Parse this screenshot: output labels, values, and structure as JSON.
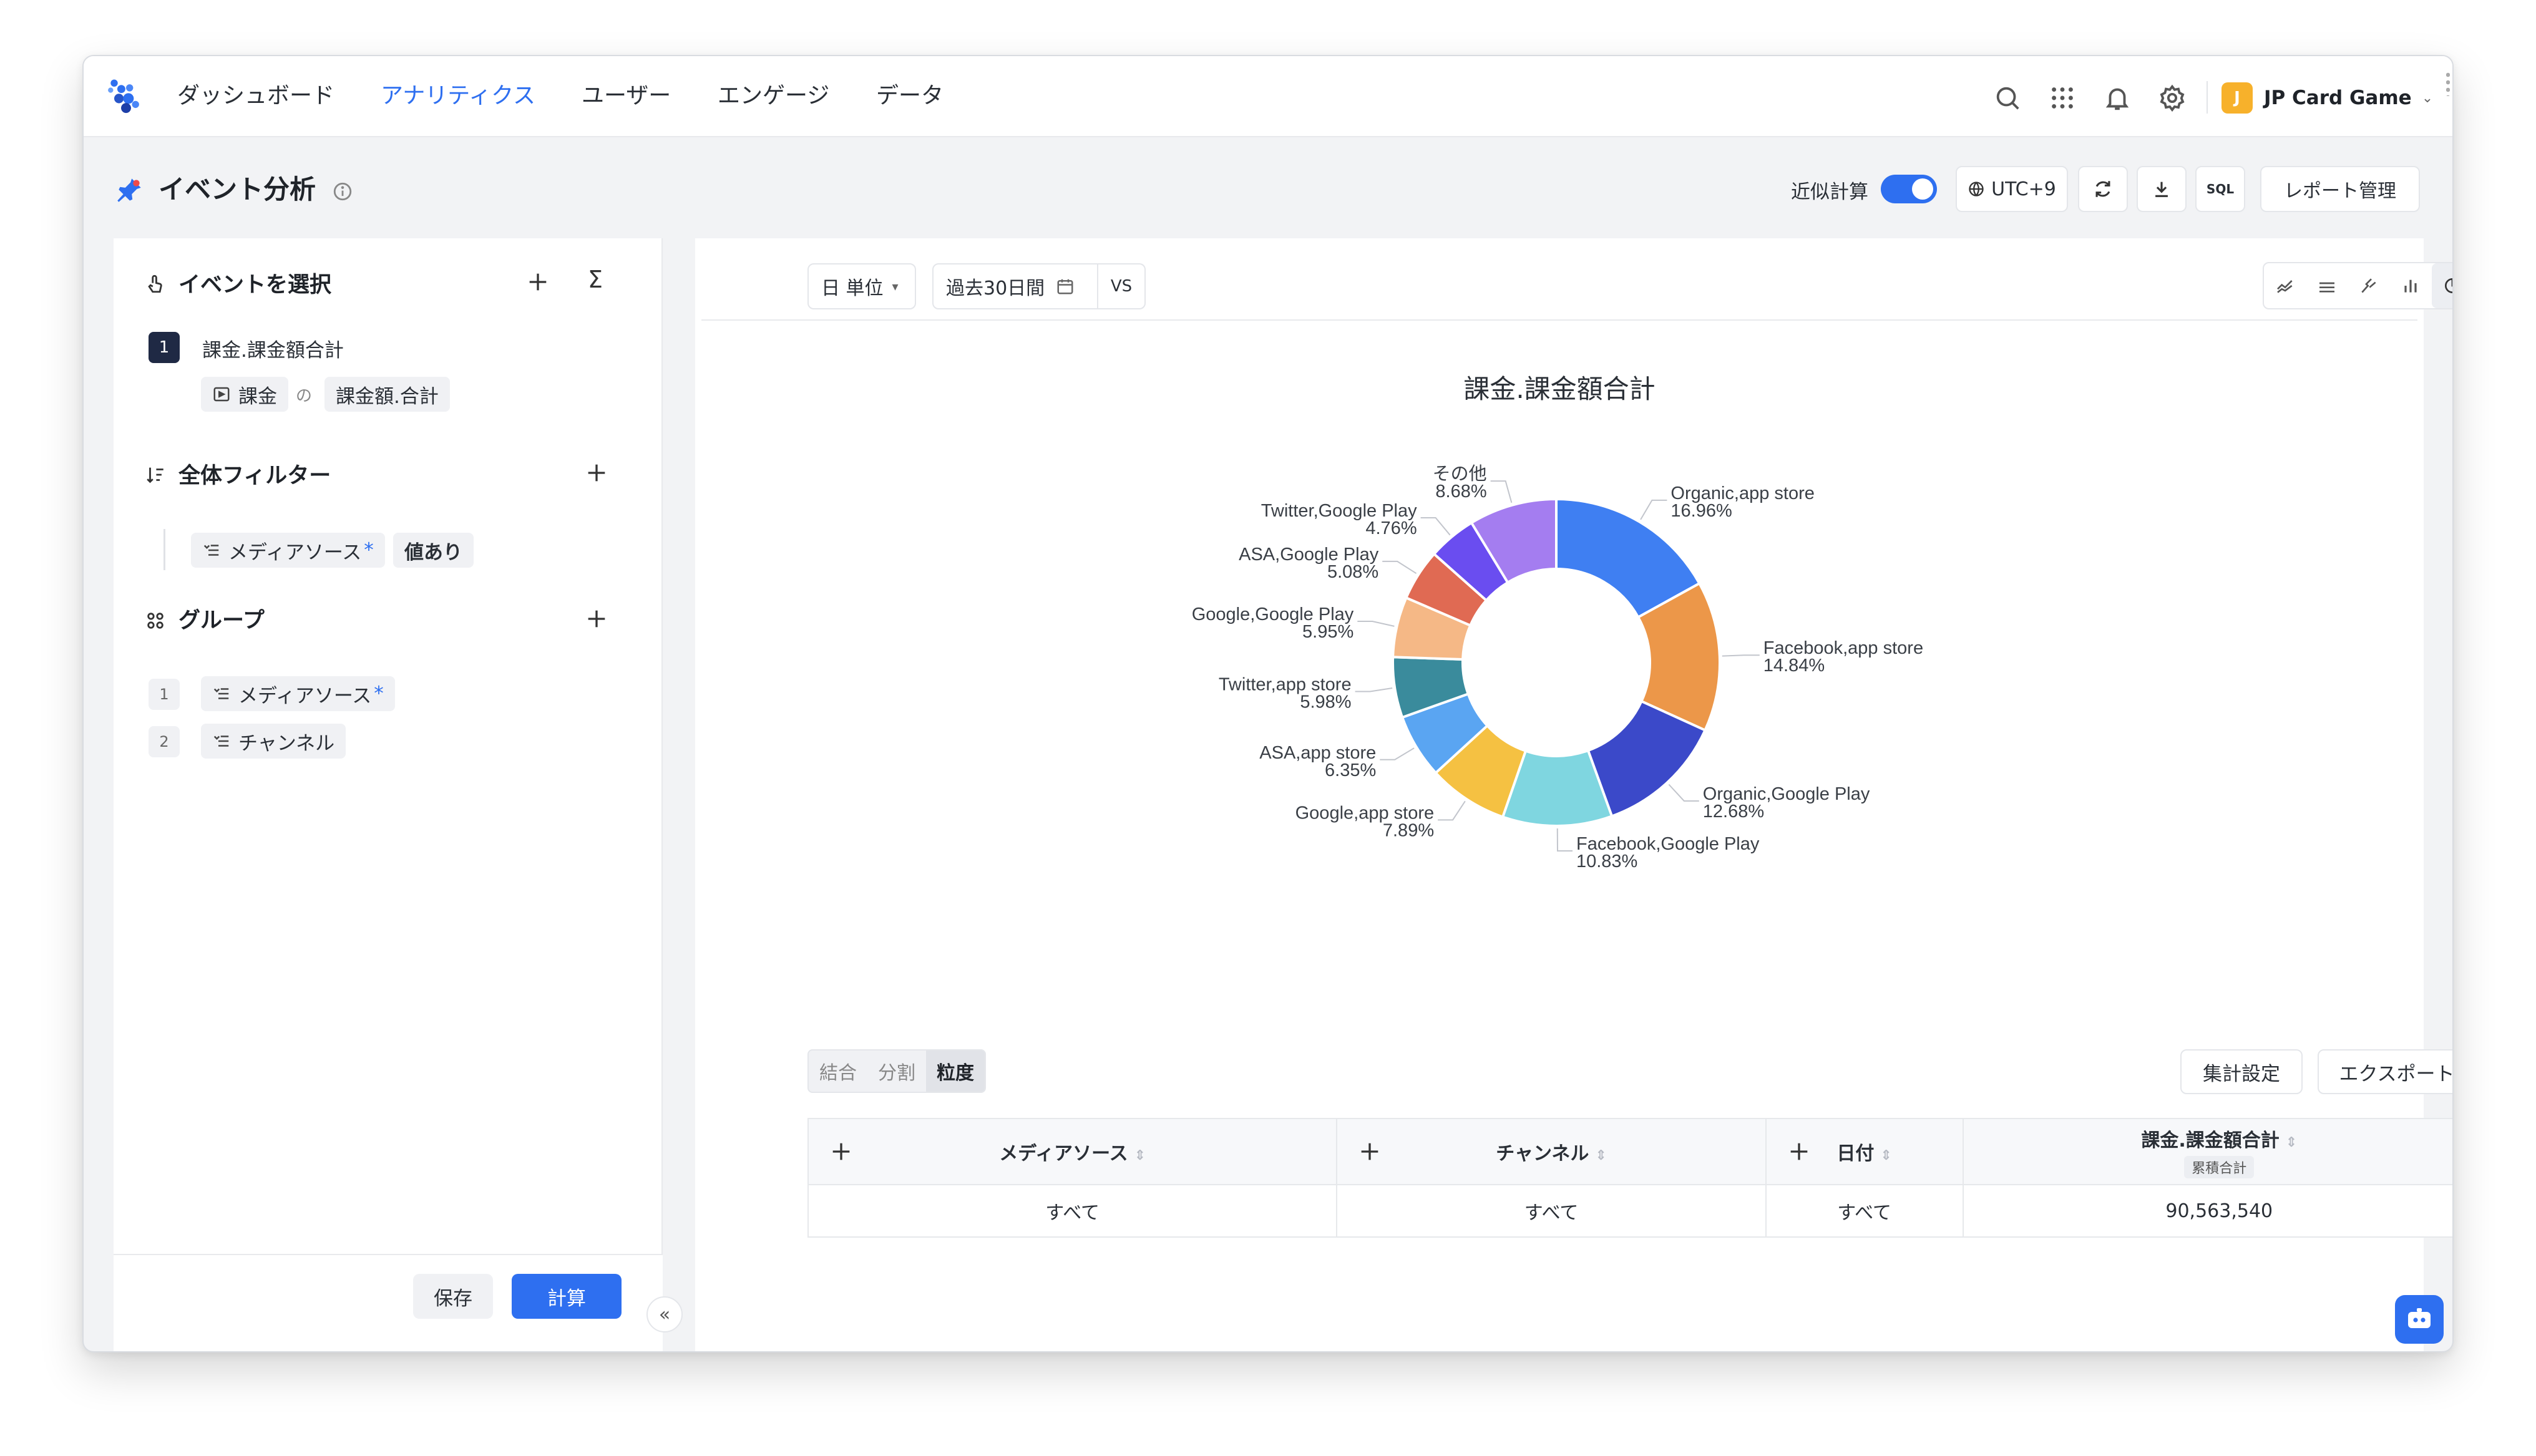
{
  "nav": {
    "items": [
      "ダッシュボード",
      "アナリティクス",
      "ユーザー",
      "エンゲージ",
      "データ"
    ],
    "active_index": 1,
    "accent_color": "#2e6ff0",
    "icons": [
      "search-icon",
      "apps-grid-icon",
      "bell-icon",
      "gear-icon"
    ],
    "project": {
      "avatar_letter": "J",
      "name": "JP Card Game",
      "avatar_color": "#f7b12b"
    }
  },
  "header": {
    "title": "イベント分析",
    "approx_label": "近似計算",
    "approx_on": true,
    "timezone": "UTC+9",
    "sql_label": "SQL",
    "report_button": "レポート管理"
  },
  "left": {
    "event_section": {
      "title": "イベントを選択",
      "sigma": "Σ"
    },
    "event": {
      "index": "1",
      "name": "課金.課金額合計",
      "source": "課金",
      "of": "の",
      "metric": "課金額.合計"
    },
    "filter_section": {
      "title": "全体フィルター"
    },
    "filter": {
      "field": "メディアソース",
      "star": "*",
      "condition": "値あり"
    },
    "group_section": {
      "title": "グループ"
    },
    "groups": [
      {
        "index": "1",
        "label": "メディアソース",
        "star": "*"
      },
      {
        "index": "2",
        "label": "チャンネル",
        "star": ""
      }
    ],
    "save_button": "保存",
    "calc_button": "計算",
    "collapse": "«"
  },
  "toolbar": {
    "granularity": "日 単位",
    "date_range": "過去30日間",
    "vs": "VS"
  },
  "chart_data": {
    "type": "pie",
    "donut": true,
    "title": "課金.課金額合計",
    "slices": [
      {
        "label": "Organic,app store",
        "percent": "16.96%",
        "value": 16.96,
        "color": "#3f7ff2"
      },
      {
        "label": "Facebook,app store",
        "percent": "14.84%",
        "value": 14.84,
        "color": "#ec9749"
      },
      {
        "label": "Organic,Google Play",
        "percent": "12.68%",
        "value": 12.68,
        "color": "#3b49c9"
      },
      {
        "label": "Facebook,Google Play",
        "percent": "10.83%",
        "value": 10.83,
        "color": "#7fd6e0"
      },
      {
        "label": "Google,app store",
        "percent": "7.89%",
        "value": 7.89,
        "color": "#f5c142"
      },
      {
        "label": "ASA,app store",
        "percent": "6.35%",
        "value": 6.35,
        "color": "#5aa5f2"
      },
      {
        "label": "Twitter,app store",
        "percent": "5.98%",
        "value": 5.98,
        "color": "#3a8b9c"
      },
      {
        "label": "Google,Google Play",
        "percent": "5.95%",
        "value": 5.95,
        "color": "#f5b886"
      },
      {
        "label": "ASA,Google Play",
        "percent": "5.08%",
        "value": 5.08,
        "color": "#e06a53"
      },
      {
        "label": "Twitter,Google Play",
        "percent": "4.76%",
        "value": 4.76,
        "color": "#6a4df0"
      },
      {
        "label": "その他",
        "percent": "8.68%",
        "value": 8.68,
        "color": "#a47df0"
      }
    ]
  },
  "table_tabs": {
    "items": [
      "結合",
      "分割",
      "粒度"
    ],
    "active_index": 2
  },
  "table_buttons": {
    "settings": "集計設定",
    "export": "エクスポート"
  },
  "table": {
    "headers": [
      {
        "label": "メディアソース"
      },
      {
        "label": "チャンネル"
      },
      {
        "label": "日付"
      },
      {
        "label": "課金.課金額合計",
        "sub": "累積合計"
      }
    ],
    "rows": [
      [
        "すべて",
        "すべて",
        "すべて",
        "90,563,540"
      ]
    ]
  }
}
